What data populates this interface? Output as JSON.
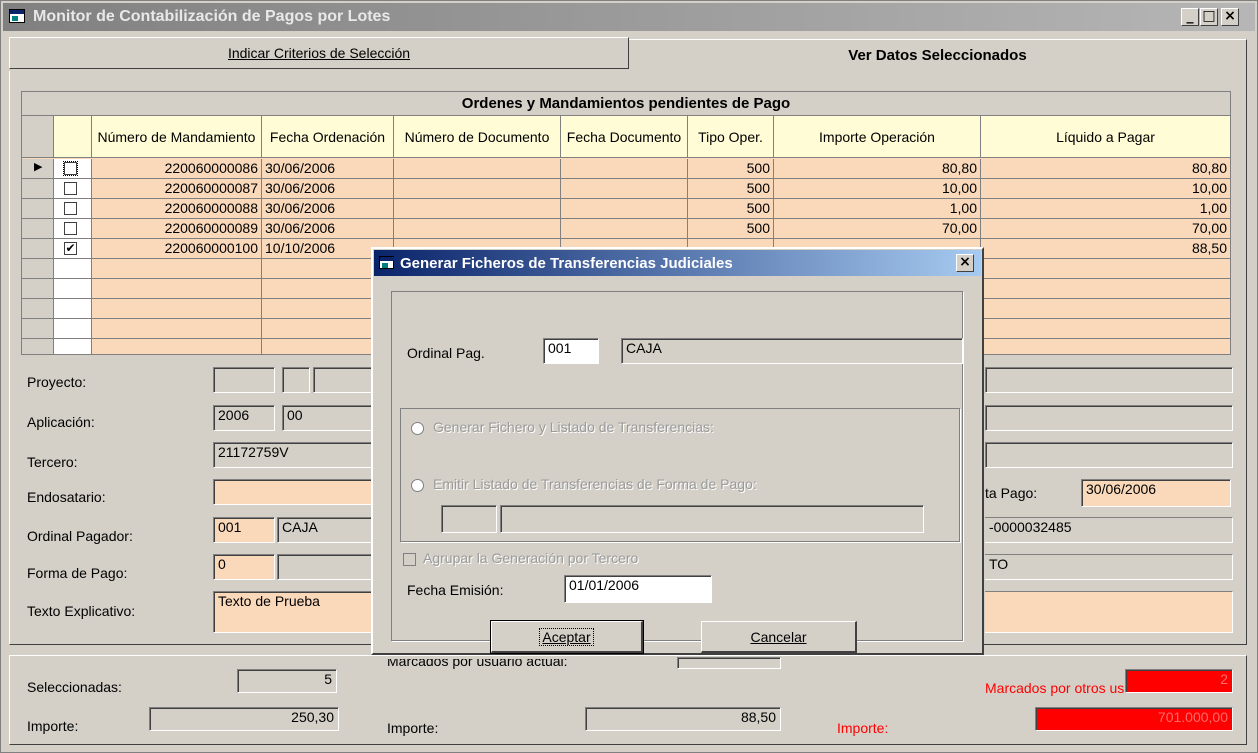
{
  "window": {
    "title": "Monitor de Contabilización de Pagos por Lotes",
    "min": "_",
    "max": "□",
    "close": "×"
  },
  "tabs": [
    {
      "label": "Indicar Criterios de Selección"
    },
    {
      "label": "Ver Datos Seleccionados"
    }
  ],
  "grid": {
    "caption": "Ordenes y Mandamientos pendientes de Pago",
    "headers": [
      "Número de Mandamiento",
      "Fecha Ordenación",
      "Número de Documento",
      "Fecha Documento",
      "Tipo Oper.",
      "Importe Operación",
      "Líquido a Pagar"
    ],
    "rows": [
      {
        "checked": "",
        "mandamiento": "220060000086",
        "fecha": "30/06/2006",
        "num_doc": "",
        "fecha_doc": "",
        "tipo": "500",
        "importe": "80,80",
        "liquido": "80,80"
      },
      {
        "checked": "",
        "mandamiento": "220060000087",
        "fecha": "30/06/2006",
        "num_doc": "",
        "fecha_doc": "",
        "tipo": "500",
        "importe": "10,00",
        "liquido": "10,00"
      },
      {
        "checked": "",
        "mandamiento": "220060000088",
        "fecha": "30/06/2006",
        "num_doc": "",
        "fecha_doc": "",
        "tipo": "500",
        "importe": "1,00",
        "liquido": "1,00"
      },
      {
        "checked": "",
        "mandamiento": "220060000089",
        "fecha": "30/06/2006",
        "num_doc": "",
        "fecha_doc": "",
        "tipo": "500",
        "importe": "70,00",
        "liquido": "70,00"
      },
      {
        "checked": "✔",
        "mandamiento": "220060000100",
        "fecha": "10/10/2006",
        "num_doc": "",
        "fecha_doc": "",
        "tipo": "",
        "importe": "",
        "liquido": "88,50"
      }
    ]
  },
  "details": {
    "proyecto_label": "Proyecto:",
    "aplicacion_label": "Aplicación:",
    "aplicacion_year": "2006",
    "aplicacion_code": "00",
    "tercero_label": "Tercero:",
    "tercero_value": "21172759V",
    "endosatario_label": "Endosatario:",
    "ordinal_label": "Ordinal Pagador:",
    "ordinal_code": "001",
    "ordinal_name": "CAJA",
    "forma_label": "Forma de Pago:",
    "forma_code": "0",
    "texto_label": "Texto Explicativo:",
    "texto_value": "Texto de Prueba",
    "fecha_pago_label": "ta Pago:",
    "fecha_pago_value": "30/06/2006",
    "ref_value": "-0000032485",
    "to_value": "TO"
  },
  "footer": {
    "seleccionadas_label": "Seleccionadas:",
    "seleccionadas_value": "5",
    "importe_label": "Importe:",
    "importe_value": "250,30",
    "marcados_label": "Marcados por usuario actual:",
    "importe2_label": "Importe:",
    "importe2_value": "88,50",
    "otros_label": "Marcados por otros usuarios:",
    "otros_value": "2",
    "importe3_label": "Importe:",
    "importe3_value": "701.000,00"
  },
  "dialog": {
    "title": "Generar Ficheros de Transferencias Judiciales",
    "close": "×",
    "ordinal_label": "Ordinal Pag.",
    "ordinal_code": "001",
    "ordinal_name": "CAJA",
    "radio1": "Generar Fichero y Listado de Transferencias:",
    "radio2": "Emitir Listado de Transferencias de Forma de Pago:",
    "agrupar": "Agrupar la Generación por Tercero",
    "fecha_label": "Fecha Emisión:",
    "fecha_value": "01/01/2006",
    "aceptar": "Aceptar",
    "cancelar": "Cancelar"
  },
  "colors": {
    "peach": "#fad9bb",
    "header_yellow": "#fffcd6",
    "active_title": "#0a246a",
    "red": "#ff0000"
  }
}
